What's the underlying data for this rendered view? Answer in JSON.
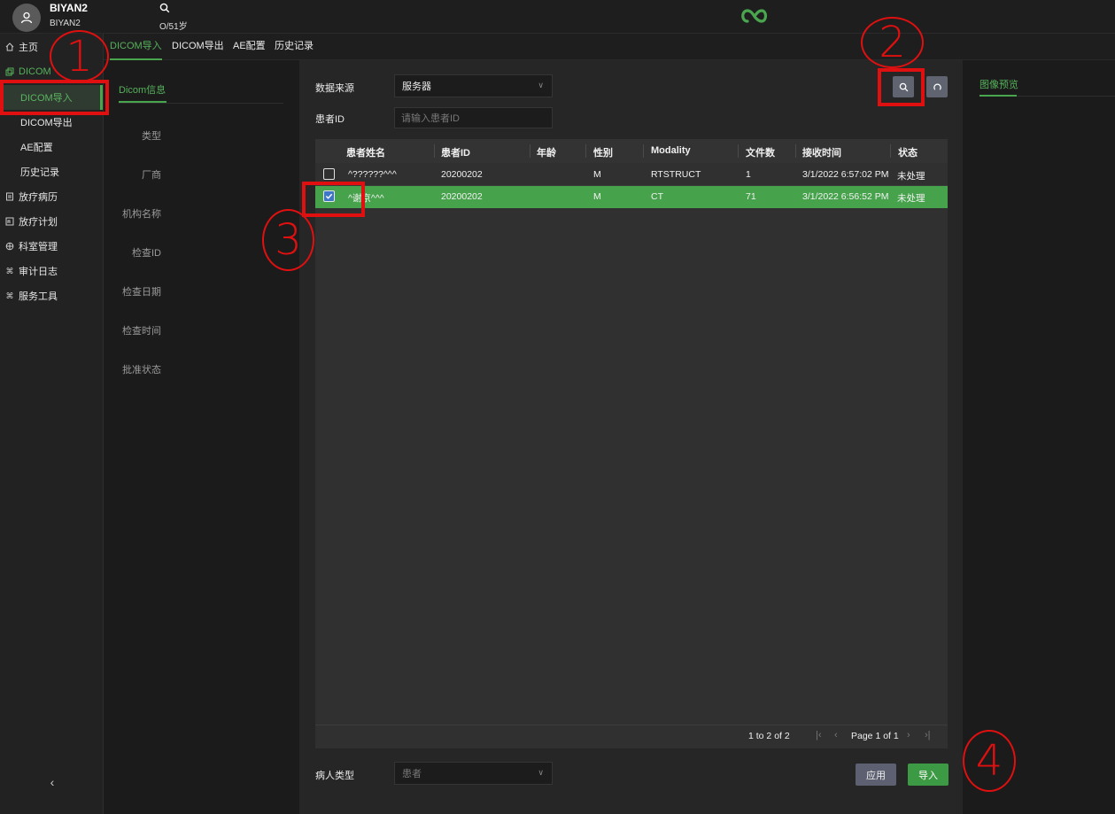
{
  "header": {
    "user_name": "BIYAN2",
    "user_sub": "BIYAN2",
    "patient_age": "O/51岁"
  },
  "sidebar": {
    "home": "主页",
    "dicom": "DICOM",
    "sub_items": [
      "DICOM导入",
      "DICOM导出",
      "AE配置",
      "历史记录"
    ],
    "items": [
      "放疗病历",
      "放疗计划",
      "科室管理",
      "审计日志",
      "服务工具"
    ]
  },
  "tabs": [
    "DICOM导入",
    "DICOM导出",
    "AE配置",
    "历史记录"
  ],
  "info_panel": {
    "tab": "Dicom信息",
    "fields": [
      "类型",
      "厂商",
      "机构名称",
      "检查ID",
      "检查日期",
      "检查时间",
      "批准状态"
    ]
  },
  "form": {
    "source_label": "数据来源",
    "source_value": "服务器",
    "patient_id_label": "患者ID",
    "patient_id_placeholder": "请输入患者ID"
  },
  "table": {
    "headers": [
      "患者姓名",
      "患者ID",
      "年龄",
      "性别",
      "Modality",
      "文件数",
      "接收时间",
      "状态"
    ],
    "rows": [
      {
        "name": "^??????^^^",
        "id": "20200202",
        "age": "",
        "sex": "M",
        "modality": "RTSTRUCT",
        "files": "1",
        "received": "3/1/2022 6:57:02 PM",
        "status": "未处理",
        "checked": false
      },
      {
        "name": "^谢京^^^",
        "id": "20200202",
        "age": "",
        "sex": "M",
        "modality": "CT",
        "files": "71",
        "received": "3/1/2022 6:56:52 PM",
        "status": "未处理",
        "checked": true
      }
    ],
    "pager": {
      "count": "1 to 2 of 2",
      "page": "Page 1 of 1"
    }
  },
  "bottom": {
    "patient_type_label": "病人类型",
    "patient_type_value": "患者",
    "apply": "应用",
    "import": "导入"
  },
  "preview": {
    "tab": "图像预览"
  },
  "annotations": [
    "1",
    "2",
    "3",
    "4"
  ],
  "colors": {
    "accent": "#4aa54f",
    "annotation": "#e01010",
    "selected_row": "#47a24c"
  }
}
